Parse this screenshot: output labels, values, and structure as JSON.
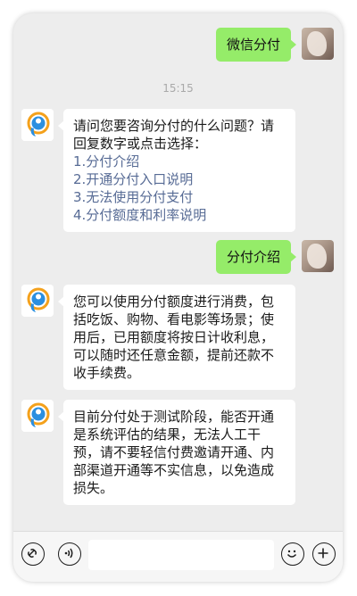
{
  "chat": {
    "timestamp": "15:15",
    "messages": [
      {
        "from": "me",
        "text": "微信分付"
      },
      {
        "from": "them",
        "intro": [
          "请问您要咨询分付的什么问题？请",
          "回复数字或点击选择："
        ],
        "options": [
          "1.分付介绍",
          "2.开通分付入口说明",
          "3.无法使用分付支付",
          "4.分付额度和利率说明"
        ]
      },
      {
        "from": "me",
        "text": "分付介绍"
      },
      {
        "from": "them",
        "lines": [
          "您可以使用分付额度进行消费，包",
          "括吃饭、购物、看电影等场景；使",
          "用后，已用额度将按日计收利息，",
          "可以随时还任意金额，提前还款不",
          "收手续费。"
        ]
      },
      {
        "from": "them",
        "lines": [
          "目前分付处于测试阶段，能否开通",
          "是系统评估的结果，无法人工干",
          "预，请不要轻信付费邀请开通、内",
          "部渠道开通等不实信息，以免造成",
          "损失。"
        ]
      }
    ]
  },
  "input_bar": {
    "voice_icon": "voice-icon",
    "link_icon": "link-icon",
    "emoji_icon": "emoji-icon",
    "plus_icon": "plus-icon"
  },
  "colors": {
    "my_bubble": "#95ec69",
    "their_bubble": "#ffffff",
    "background": "#ededed",
    "option_link": "#576b95"
  }
}
